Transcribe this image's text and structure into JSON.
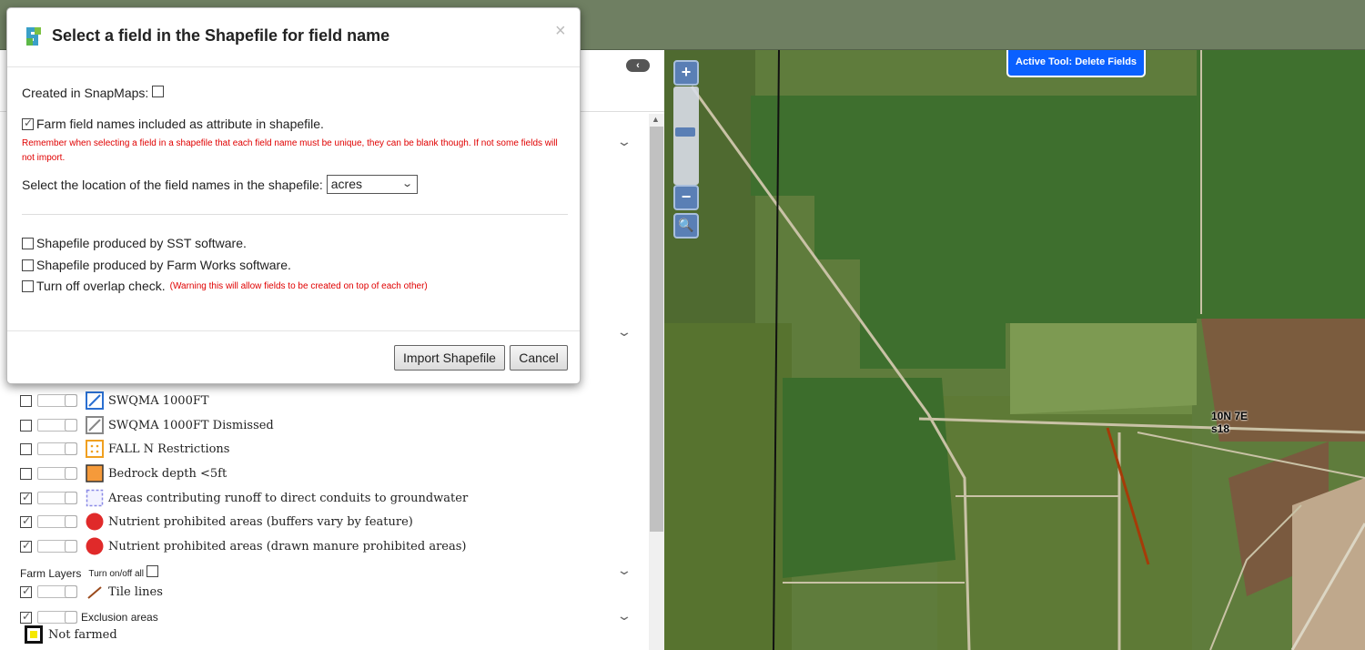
{
  "modal": {
    "title": "Select a field in the Shapefile for field name",
    "close": "×",
    "created_in_snapmaps": "Created in SnapMaps:",
    "farm_field_names": "Farm field names included as attribute in shapefile.",
    "unique_note": "Remember when selecting a field in a shapefile that each field name must be unique, they can be blank though. If not some fields will not import.",
    "select_location_label": "Select the location of the field names in the shapefile:",
    "select_value": "acres",
    "sst": "Shapefile produced by SST software.",
    "farmworks": "Shapefile produced by Farm Works software.",
    "overlap": "Turn off overlap check.",
    "overlap_warning": "(Warning this will allow fields to be created on top of each other)",
    "import_button": "Import Shapefile",
    "cancel_button": "Cancel"
  },
  "panel": {
    "collapse": "‹"
  },
  "layers": [
    {
      "label": "SWQMA 1000FT",
      "checked": false
    },
    {
      "label": "SWQMA 1000FT Dismissed",
      "checked": false
    },
    {
      "label": "FALL N Restrictions",
      "checked": false
    },
    {
      "label": "Bedrock depth <5ft",
      "checked": false
    },
    {
      "label": "Areas contributing runoff to direct conduits to groundwater",
      "checked": true
    },
    {
      "label": "Nutrient prohibited areas (buffers vary by feature)",
      "checked": true
    },
    {
      "label": "Nutrient prohibited areas (drawn manure prohibited areas)",
      "checked": true
    }
  ],
  "farm_layers": {
    "title": "Farm Layers",
    "toggle_all": "Turn on/off all",
    "tile_lines": "Tile lines",
    "exclusion_areas": "Exclusion areas",
    "not_farmed": "Not farmed"
  },
  "map": {
    "active_tool": "Active Tool: Delete Fields",
    "zoom_in": "+",
    "zoom_out": "−",
    "township_line1": "10N 7E",
    "township_line2": "s18"
  }
}
